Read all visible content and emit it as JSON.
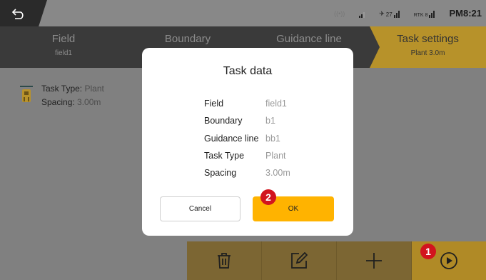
{
  "status_bar": {
    "time": "PM8:21",
    "rtk_label": "RTK",
    "rtk_count": "8",
    "sat_count": "27"
  },
  "steps": [
    {
      "title": "Field",
      "subtitle": "field1"
    },
    {
      "title": "Boundary",
      "subtitle": ""
    },
    {
      "title": "Guidance line",
      "subtitle": ""
    },
    {
      "title": "Task settings",
      "subtitle": "Plant 3.0m"
    }
  ],
  "task_info": {
    "type_label": "Task Type:",
    "type_value": "Plant",
    "spacing_label": "Spacing:",
    "spacing_value": "3.00m"
  },
  "dialog": {
    "title": "Task data",
    "rows": [
      {
        "key": "Field",
        "value": "field1"
      },
      {
        "key": "Boundary",
        "value": "b1"
      },
      {
        "key": "Guidance line",
        "value": "bb1"
      },
      {
        "key": "Task Type",
        "value": "Plant"
      },
      {
        "key": "Spacing",
        "value": "3.00m"
      }
    ],
    "cancel_label": "Cancel",
    "ok_label": "OK"
  },
  "badges": {
    "start": "1",
    "ok": "2"
  },
  "colors": {
    "accent": "#ffb300",
    "badge": "#d2141e",
    "nav_bg": "#3a3a3a"
  },
  "icons": [
    "back-icon",
    "trash-icon",
    "edit-icon",
    "add-icon",
    "play-icon",
    "tractor-icon"
  ]
}
